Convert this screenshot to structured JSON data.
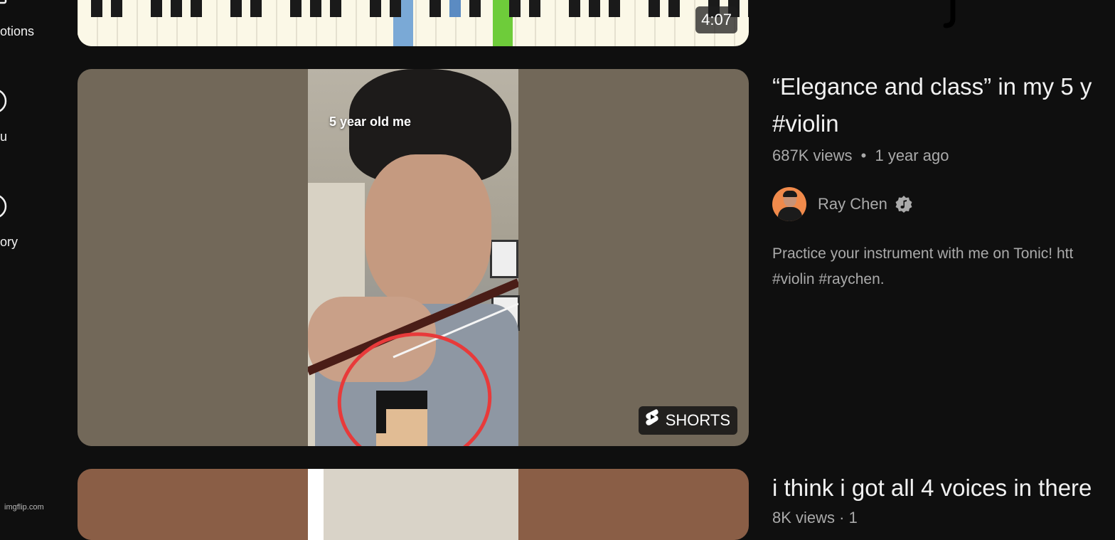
{
  "sidebar": {
    "items": [
      {
        "label": "otions",
        "icon": "playlist-icon"
      },
      {
        "label": "u",
        "icon": "your-videos-icon"
      },
      {
        "label": "ory",
        "icon": "history-icon"
      }
    ]
  },
  "videos": [
    {
      "duration": "4:07"
    },
    {
      "title_line1": "“Elegance and class” in my 5 y",
      "title_line2": "#violin",
      "views": "687K views",
      "age": "1 year ago",
      "channel": "Ray Chen",
      "description_line1": "Practice your instrument with me on Tonic! htt",
      "description_line2": "#violin #raychen.",
      "overlay_caption": "5 year old me",
      "badge": "SHORTS"
    },
    {
      "title_line1": "i think i got all 4 voices in there",
      "meta_partial": "8K views · 1"
    }
  ],
  "watermark": "imgflip.com",
  "colors": {
    "background": "#0f0f0f",
    "title": "#f1f1f1",
    "meta": "#aaaaaa",
    "thumb_main_bg": "#726859",
    "avatar_bg": "#f08a4b",
    "annotation_circle": "#e83a3a"
  }
}
